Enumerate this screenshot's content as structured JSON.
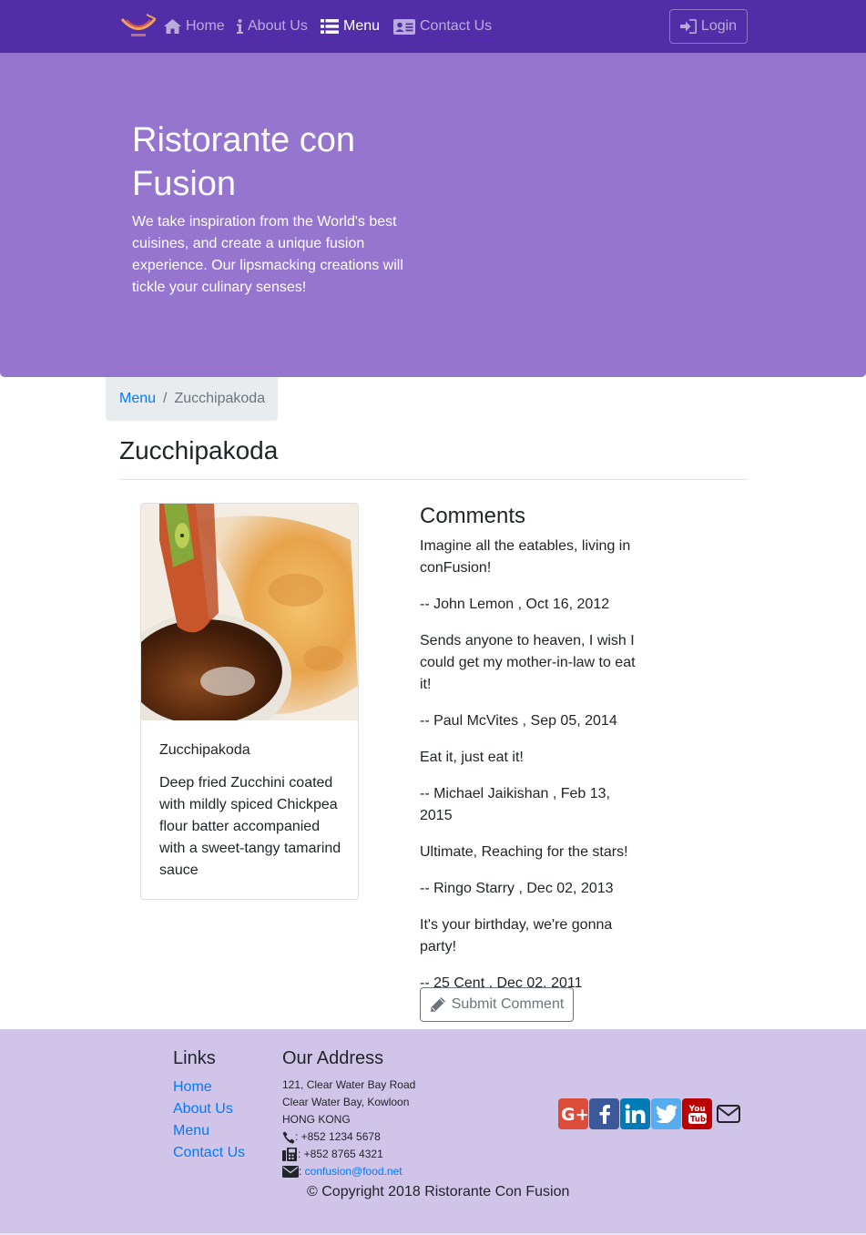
{
  "nav": {
    "items": [
      {
        "label": "Home",
        "icon": "home-icon"
      },
      {
        "label": "About Us",
        "icon": "info-icon"
      },
      {
        "label": "Menu",
        "icon": "list-icon",
        "active": true
      },
      {
        "label": "Contact Us",
        "icon": "address-card-icon"
      }
    ],
    "login_label": "Login"
  },
  "jumbotron": {
    "title": "Ristorante con Fusion",
    "text": "We take inspiration from the World's best cuisines, and create a unique fusion experience. Our lipsmacking creations will tickle your culinary senses!"
  },
  "breadcrumb": {
    "parent": "Menu",
    "current": "Zucchipakoda"
  },
  "page_title": "Zucchipakoda",
  "dish": {
    "name": "Zucchipakoda",
    "description": "Deep fried Zucchini coated with mildly spiced Chickpea flour batter accompanied with a sweet-tangy tamarind sauce"
  },
  "comments": {
    "heading": "Comments",
    "items": [
      {
        "text": "Imagine all the eatables, living in conFusion!",
        "byline": "-- John Lemon , Oct 16, 2012"
      },
      {
        "text": "Sends anyone to heaven, I wish I could get my mother-in-law to eat it!",
        "byline": "-- Paul McVites , Sep 05, 2014"
      },
      {
        "text": "Eat it, just eat it!",
        "byline": "-- Michael Jaikishan , Feb 13, 2015"
      },
      {
        "text": "Ultimate, Reaching for the stars!",
        "byline": "-- Ringo Starry , Dec 02, 2013"
      },
      {
        "text": "It's your birthday, we're gonna party!",
        "byline": "-- 25 Cent , Dec 02, 2011"
      }
    ],
    "submit_label": "Submit Comment"
  },
  "footer": {
    "links_heading": "Links",
    "links": [
      "Home",
      "About Us",
      "Menu",
      "Contact Us"
    ],
    "address_heading": "Our Address",
    "address_lines": [
      "121, Clear Water Bay Road",
      "Clear Water Bay, Kowloon",
      "HONG KONG"
    ],
    "phone": ": +852 1234 5678",
    "fax": ": +852 8765 4321",
    "email_sep": ": ",
    "email": "confusion@food.net",
    "social": [
      {
        "icon": "google-plus-icon",
        "color": "#dd4b39"
      },
      {
        "icon": "facebook-icon",
        "color": "#3b5998"
      },
      {
        "icon": "linkedin-icon",
        "color": "#007bb6"
      },
      {
        "icon": "twitter-icon",
        "color": "#55acee"
      },
      {
        "icon": "youtube-icon",
        "color": "#bb0000"
      },
      {
        "icon": "envelope-icon",
        "color": "#212529"
      }
    ],
    "copyright": "© Copyright 2018 Ristorante Con Fusion"
  },
  "colors": {
    "primary": "#512da8",
    "jumbotron": "#9575cd",
    "footer": "#d1c4e9",
    "link": "#007bff"
  }
}
